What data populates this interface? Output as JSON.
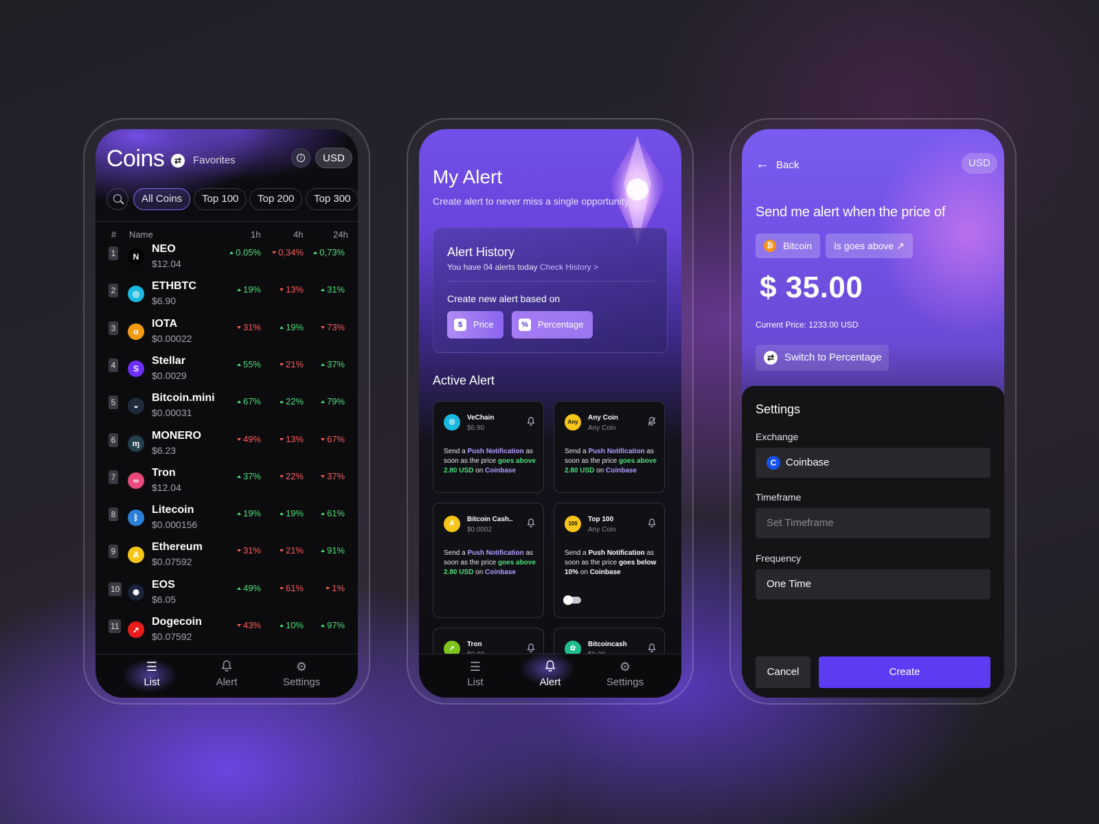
{
  "colors": {
    "accent": "#6b4cf2",
    "up": "#4fe07a",
    "down": "#ff5c5c",
    "link_purple": "#b49cff"
  },
  "list_screen": {
    "title": "Coins",
    "favorites_label": "Favorites",
    "currency": "USD",
    "tabs": [
      "All Coins",
      "Top 100",
      "Top 200",
      "Top 300"
    ],
    "active_tab": "All Coins",
    "columns": {
      "rank": "#",
      "name": "Name",
      "h1": "1h",
      "h4": "4h",
      "h24": "24h"
    },
    "rows": [
      {
        "rank": "1",
        "name": "NEO",
        "price": "$12.04",
        "h1": "0.05%",
        "h1_dir": "up",
        "h4": "0,34%",
        "h4_dir": "down",
        "h24": "0,73%",
        "h24_dir": "up",
        "icon": "neo-icon",
        "icon_color": "#000000",
        "glyph": "N"
      },
      {
        "rank": "2",
        "name": "ETHBTC",
        "price": "$6.90",
        "h1": "19%",
        "h1_dir": "up",
        "h4": "13%",
        "h4_dir": "down",
        "h24": "31%",
        "h24_dir": "up",
        "icon": "ethbtc-icon",
        "icon_color": "#19b8e0",
        "glyph": "◎"
      },
      {
        "rank": "3",
        "name": "IOTA",
        "price": "$0.00022",
        "h1": "31%",
        "h1_dir": "down",
        "h4": "19%",
        "h4_dir": "up",
        "h24": "73%",
        "h24_dir": "down",
        "icon": "iota-icon",
        "icon_color": "#f39c12",
        "glyph": "α"
      },
      {
        "rank": "4",
        "name": "Stellar",
        "price": "$0.0029",
        "h1": "55%",
        "h1_dir": "up",
        "h4": "21%",
        "h4_dir": "down",
        "h24": "37%",
        "h24_dir": "up",
        "icon": "stellar-icon",
        "icon_color": "#6b2ef5",
        "glyph": "S"
      },
      {
        "rank": "5",
        "name": "Bitcoin.mini",
        "price": "$0.00031",
        "h1": "67%",
        "h1_dir": "up",
        "h4": "22%",
        "h4_dir": "up",
        "h24": "79%",
        "h24_dir": "up",
        "icon": "bitcoin-mini-icon",
        "icon_color": "#1d2a3a",
        "glyph": "◒"
      },
      {
        "rank": "6",
        "name": "MONERO",
        "price": "$6.23",
        "h1": "49%",
        "h1_dir": "down",
        "h4": "13%",
        "h4_dir": "down",
        "h24": "67%",
        "h24_dir": "down",
        "icon": "monero-icon",
        "icon_color": "#23414a",
        "glyph": "ɱ"
      },
      {
        "rank": "7",
        "name": "Tron",
        "price": "$12.04",
        "h1": "37%",
        "h1_dir": "up",
        "h4": "22%",
        "h4_dir": "down",
        "h24": "37%",
        "h24_dir": "down",
        "icon": "tron-icon",
        "icon_color": "#e94a7b",
        "glyph": "∞"
      },
      {
        "rank": "8",
        "name": "Litecoin",
        "price": "$0.000156",
        "h1": "19%",
        "h1_dir": "up",
        "h4": "19%",
        "h4_dir": "up",
        "h24": "61%",
        "h24_dir": "up",
        "icon": "litecoin-icon",
        "icon_color": "#2a7fd9",
        "glyph": "ᛒ"
      },
      {
        "rank": "9",
        "name": "Ethereum",
        "price": "$0.07592",
        "h1": "31%",
        "h1_dir": "down",
        "h4": "21%",
        "h4_dir": "down",
        "h24": "91%",
        "h24_dir": "up",
        "icon": "ethereum-icon",
        "icon_color": "#f5c518",
        "glyph": "Ⱥ"
      },
      {
        "rank": "10",
        "name": "EOS",
        "price": "$6.05",
        "h1": "49%",
        "h1_dir": "up",
        "h4": "61%",
        "h4_dir": "down",
        "h24": "1%",
        "h24_dir": "down",
        "icon": "eos-icon",
        "icon_color": "#182238",
        "glyph": "✺"
      },
      {
        "rank": "11",
        "name": "Dogecoin",
        "price": "$0.07592",
        "h1": "43%",
        "h1_dir": "down",
        "h4": "10%",
        "h4_dir": "up",
        "h24": "97%",
        "h24_dir": "up",
        "icon": "dogecoin-icon",
        "icon_color": "#e81c1c",
        "glyph": "➚"
      }
    ],
    "nav": [
      {
        "label": "List",
        "icon": "list-icon",
        "selected": true
      },
      {
        "label": "Alert",
        "icon": "bell-icon",
        "selected": false
      },
      {
        "label": "Settings",
        "icon": "gear-icon",
        "selected": false
      }
    ]
  },
  "alert_screen": {
    "title": "My Alert",
    "subtitle": "Create alert to never miss a single opportunity",
    "history_title": "Alert History",
    "history_text": "You have 04 alerts today",
    "history_link": "Check History >",
    "create_label": "Create new alert based on",
    "price_btn": "Price",
    "percentage_btn": "Percentage",
    "active_title": "Active Alert",
    "cards": [
      {
        "coin": "VeChain",
        "sub": "$6.90",
        "icon_color": "#19b8e0",
        "glyph": "◎",
        "m1": "Send a ",
        "m2": "Push Notification",
        "m3": " as soon as the price ",
        "m4": "goes above 2.80 USD",
        "m5": " on ",
        "m6": "Coinbase",
        "bell_off": false
      },
      {
        "coin": "Any Coin",
        "sub": "Any Coin",
        "icon_color": "#f5c518",
        "glyph": "Any",
        "m1": "Send a ",
        "m2": "Push Notification",
        "m3": " as soon as the price ",
        "m4": "goes above 2.80 USD",
        "m5": " on ",
        "m6": "Coinbase",
        "bell_off": true
      },
      {
        "coin": "Bitcoin Cash..",
        "sub": "$0.0002",
        "icon_color": "#f5c518",
        "glyph": "Ⱥ",
        "m1": "Send a ",
        "m2": "Push Notification",
        "m3": " as soon as the price ",
        "m4": "goes above 2.80 USD",
        "m5": " on ",
        "m6": "Coinbase",
        "bell_off": false
      },
      {
        "coin": "Top 100",
        "sub": "Any Coin",
        "icon_color": "#f5c518",
        "glyph": "100",
        "m1": "Send a ",
        "m2": "Push Notification",
        "m3": " as soon as the price ",
        "m4": "goes below 10%",
        "m5": " on ",
        "m6": "Coinbase",
        "bell_off": false
      },
      {
        "coin": "Tron",
        "sub": "$0.00",
        "icon_color": "#7ec41a",
        "glyph": "➚"
      },
      {
        "coin": "Bitcoincash",
        "sub": "$0.00",
        "icon_color": "#1fbf8f",
        "glyph": "✿"
      }
    ],
    "nav": [
      {
        "label": "List",
        "icon": "list-icon",
        "selected": false
      },
      {
        "label": "Alert",
        "icon": "bell-icon",
        "selected": true
      },
      {
        "label": "Settings",
        "icon": "gear-icon",
        "selected": false
      }
    ]
  },
  "create_screen": {
    "back_label": "Back",
    "currency": "USD",
    "question": "Send me alert when the price of",
    "coin_chip": "Bitcoin",
    "condition_chip": "Is goes above",
    "amount": "$ 35.00",
    "current_price": "Current Price: 1233.00 USD",
    "switch_label": "Switch to Percentage",
    "settings_title": "Settings",
    "exchange_label": "Exchange",
    "exchange_value": "Coinbase",
    "timeframe_label": "Timeframe",
    "timeframe_placeholder": "Set Timeframe",
    "frequency_label": "Frequency",
    "frequency_value": "One Time",
    "cancel_label": "Cancel",
    "create_label": "Create"
  }
}
